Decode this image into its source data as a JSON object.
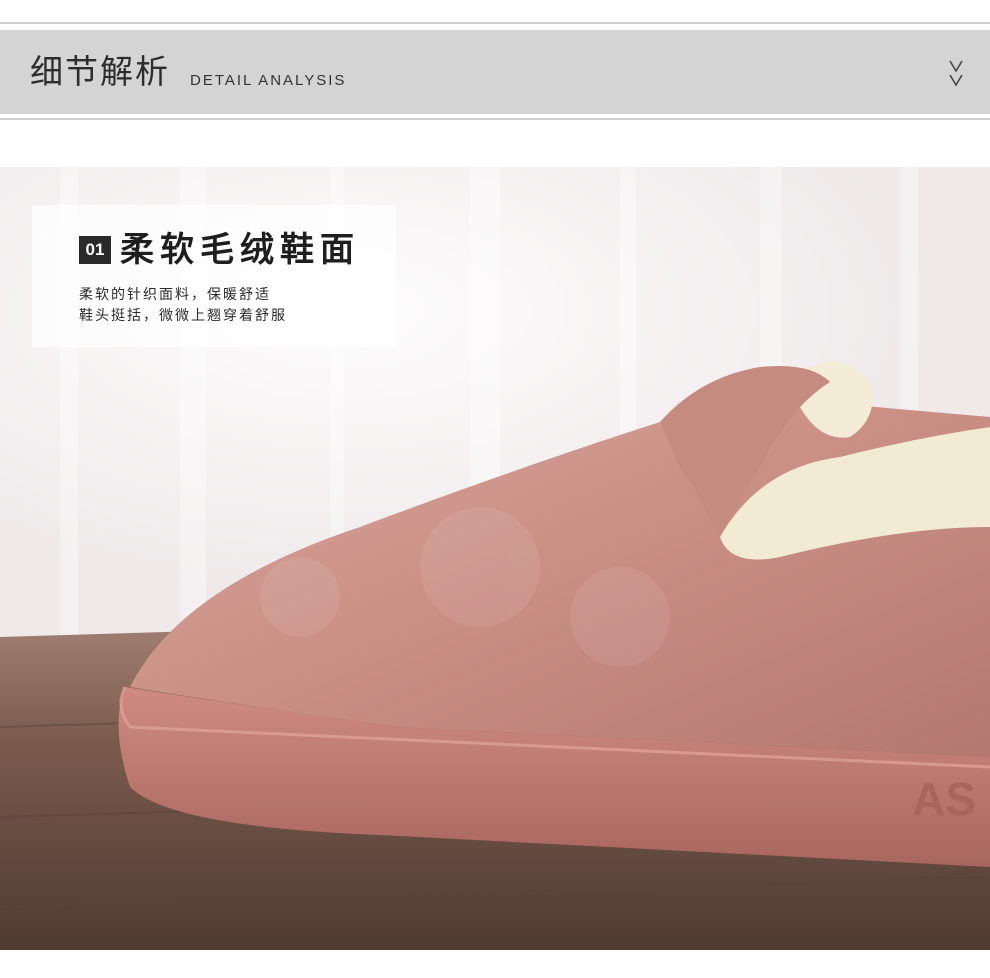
{
  "header": {
    "title": "细节解析",
    "subtitle": "DETAIL ANALYSIS",
    "chevron_icon": "double-chevron-down-icon"
  },
  "detail": {
    "number": "01",
    "title": "柔软毛绒鞋面",
    "lines": [
      "柔软的针织面料，保暖舒适",
      "鞋头挺括，微微上翘穿着舒服"
    ]
  },
  "photo": {
    "sole_logo_text": "AS",
    "colors": {
      "upper": "#c98e84",
      "sole": "#c27f76",
      "fleece": "#f2ead2",
      "floor": "#6b4f44",
      "background": "#efe9ea"
    }
  }
}
